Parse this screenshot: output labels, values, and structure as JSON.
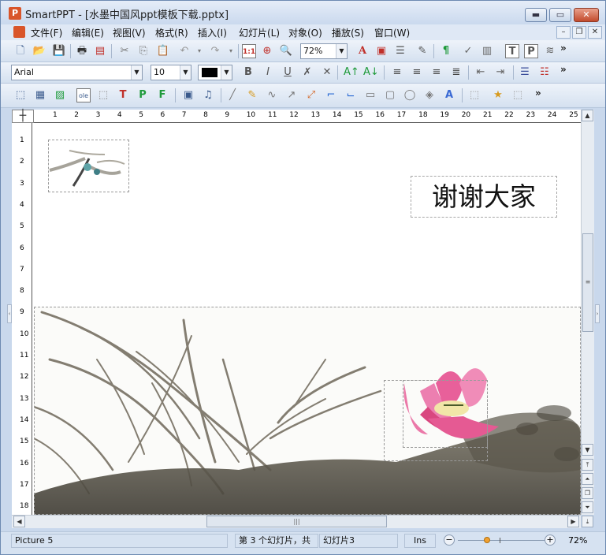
{
  "window": {
    "title": "SmartPPT - [水墨中国风ppt模板下载.pptx]",
    "app_icon": "P"
  },
  "window_controls": {
    "minimize": "▬",
    "restore": "▭",
    "close": "✕"
  },
  "menu": [
    "文件(F)",
    "编辑(E)",
    "视图(V)",
    "格式(R)",
    "插入(I)",
    "幻灯片(L)",
    "对象(O)",
    "播放(S)",
    "窗口(W)"
  ],
  "mdi_controls": {
    "minimize": "–",
    "restore": "❐",
    "close": "✕"
  },
  "toolbar1": {
    "zoom_value": "72%",
    "more": "»"
  },
  "toolbar2": {
    "font_name": "Arial",
    "font_size": "10",
    "more": "»"
  },
  "toolbar3": {
    "more": "»"
  },
  "hruler": [
    "1",
    "2",
    "3",
    "4",
    "5",
    "6",
    "7",
    "8",
    "9",
    "10",
    "11",
    "12",
    "13",
    "14",
    "15",
    "16",
    "17",
    "18",
    "19",
    "20",
    "21",
    "22",
    "23",
    "24",
    "25"
  ],
  "vruler": [
    "1",
    "2",
    "3",
    "4",
    "5",
    "6",
    "7",
    "8",
    "9",
    "10",
    "11",
    "12",
    "13",
    "14",
    "15",
    "16",
    "17",
    "18"
  ],
  "slide": {
    "thanks_text": "谢谢大家"
  },
  "statusbar": {
    "object_name": "Picture 5",
    "slide_count": "第 3 个幻灯片，共",
    "slide_name": "幻灯片3",
    "mode": "Ins",
    "zoom": "72%",
    "zoom_fraction": 0.34
  },
  "colors": {
    "titlebar": "#cad9ee",
    "close_button": "#c24a2c",
    "lotus": "#e8609a",
    "ink": "#4a463c"
  }
}
